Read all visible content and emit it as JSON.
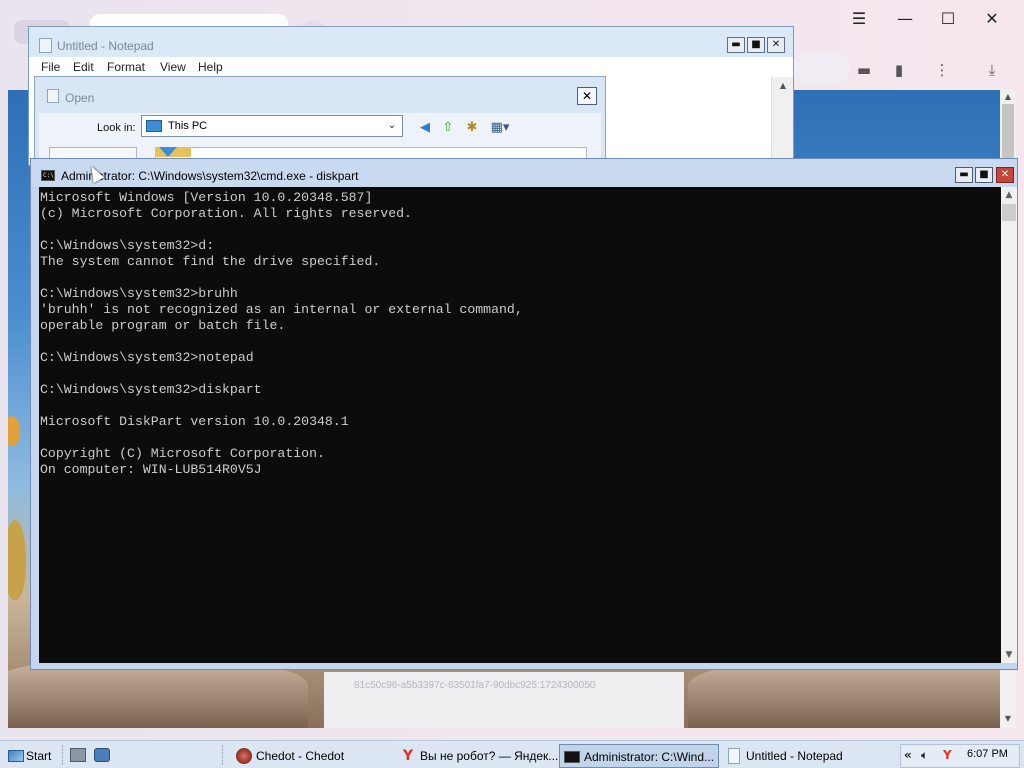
{
  "notepad": {
    "title": "Untitled - Notepad",
    "menu": [
      "File",
      "Edit",
      "Format",
      "View",
      "Help"
    ],
    "controls": {
      "minimize": "▬",
      "maximize": "■",
      "close": "✕"
    }
  },
  "open_dialog": {
    "title": "Open",
    "look_in_label": "Look in:",
    "look_in_value": "This PC",
    "close": "✕"
  },
  "cmd": {
    "title": "Administrator: C:\\Windows\\system32\\cmd.exe - diskpart",
    "controls": {
      "minimize": "▬",
      "maximize": "■",
      "close": "✕"
    },
    "lines": [
      "Microsoft Windows [Version 10.0.20348.587]",
      "(c) Microsoft Corporation. All rights reserved.",
      "",
      "C:\\Windows\\system32>d:",
      "The system cannot find the drive specified.",
      "",
      "C:\\Windows\\system32>bruhh",
      "'bruhh' is not recognized as an internal or external command,",
      "operable program or batch file.",
      "",
      "C:\\Windows\\system32>notepad",
      "",
      "C:\\Windows\\system32>diskpart",
      "",
      "Microsoft DiskPart version 10.0.20348.1",
      "",
      "Copyright (C) Microsoft Corporation.",
      "On computer: WIN-LUB514R0V5J"
    ]
  },
  "browser": {
    "controls": {
      "menu": "☰",
      "minimize": "—",
      "maximize": "☐",
      "close": "✕"
    },
    "page_hash": "81c50c96-a5b3397c-63501fa7-90dbc925:1724300050"
  },
  "taskbar": {
    "start_label": "Start",
    "tasks": [
      {
        "label": "Chedot - Chedot",
        "active": false
      },
      {
        "label": "Вы не робот? — Яндек...",
        "active": false
      },
      {
        "label": "Administrator: C:\\Wind...",
        "active": true
      },
      {
        "label": "Untitled - Notepad",
        "active": false
      }
    ],
    "tray_chevron": "«",
    "clock": "6:07 PM"
  },
  "colors": {
    "console_bg": "#0c0c0c",
    "console_fg": "#cccccc",
    "titlebar": "#c9daf0",
    "close_red": "#c7443b",
    "taskbar": "#dce6f2"
  }
}
